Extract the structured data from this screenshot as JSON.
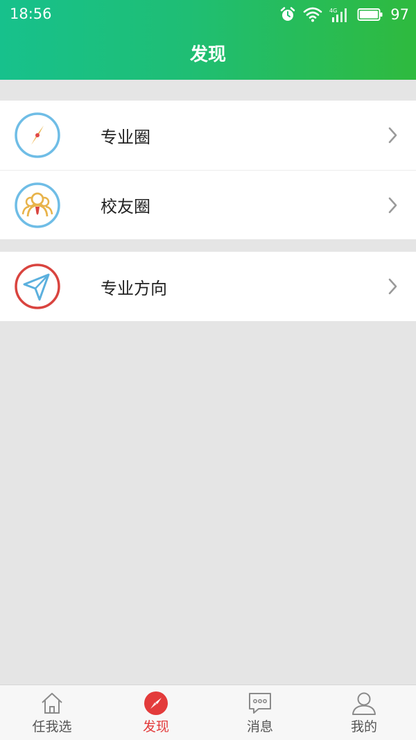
{
  "status": {
    "time": "18:56",
    "network": "4G",
    "battery": "97"
  },
  "header": {
    "title": "发现"
  },
  "groups": [
    {
      "items": [
        {
          "label": "专业圈",
          "icon": "compass-icon"
        },
        {
          "label": "校友圈",
          "icon": "alumni-people-icon"
        }
      ]
    },
    {
      "items": [
        {
          "label": "专业方向",
          "icon": "paper-plane-icon"
        }
      ]
    }
  ],
  "tabs": [
    {
      "label": "任我选",
      "icon": "home-icon",
      "active": false
    },
    {
      "label": "发现",
      "icon": "compass-icon",
      "active": true
    },
    {
      "label": "消息",
      "icon": "chat-bubble-icon",
      "active": false
    },
    {
      "label": "我的",
      "icon": "person-icon",
      "active": false
    }
  ],
  "colors": {
    "header_start": "#17c18c",
    "header_end": "#2fba3e",
    "active_tab": "#e33b3b",
    "background": "#e5e5e5"
  }
}
